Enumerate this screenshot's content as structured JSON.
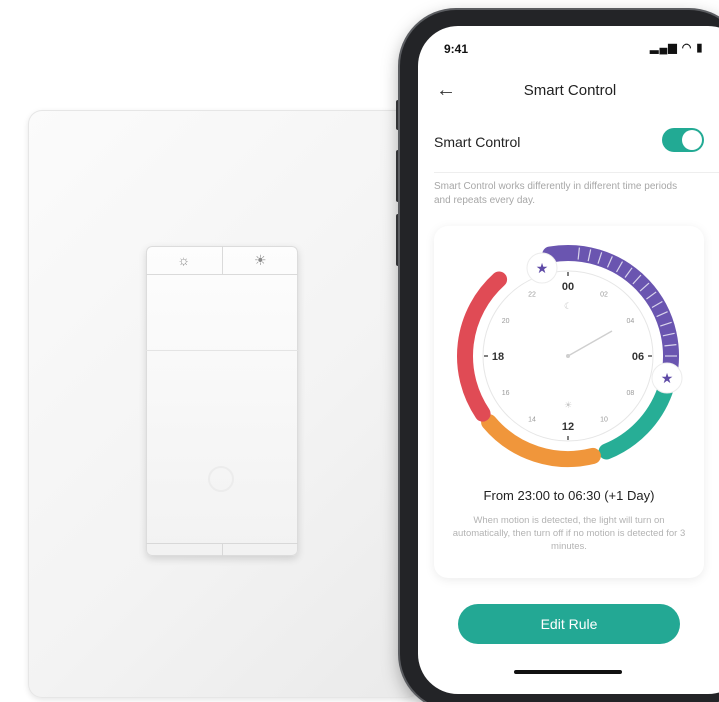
{
  "status_bar": {
    "time": "9:41",
    "icons": "▂▄▆ ◠ ▮"
  },
  "nav": {
    "back_icon": "arrow-left-icon",
    "title": "Smart Control"
  },
  "smart_control": {
    "label": "Smart Control",
    "enabled": true
  },
  "description": "Smart Control works differently in different time periods and repeats every day.",
  "dial": {
    "hour_labels": {
      "major": [
        "00",
        "06",
        "12",
        "18"
      ],
      "minor": [
        "02",
        "04",
        "08",
        "10",
        "14",
        "16",
        "20",
        "22"
      ]
    },
    "segments": [
      {
        "name": "red",
        "color": "#e04b55"
      },
      {
        "name": "purple",
        "color": "#6a55b0"
      },
      {
        "name": "green",
        "color": "#27ae96"
      },
      {
        "name": "orange",
        "color": "#f0963b"
      }
    ],
    "star_icon": "star-icon"
  },
  "rule": {
    "range": "From 23:00 to 06:30 (+1 Day)",
    "note": "When motion is detected, the light will turn on automatically, then turn off if no motion is detected for 3 minutes."
  },
  "edit_button": {
    "label": "Edit Rule"
  },
  "colors": {
    "accent": "#23a894",
    "background": "#ffffff",
    "text": "#222222",
    "muted": "#a7a7a7"
  }
}
